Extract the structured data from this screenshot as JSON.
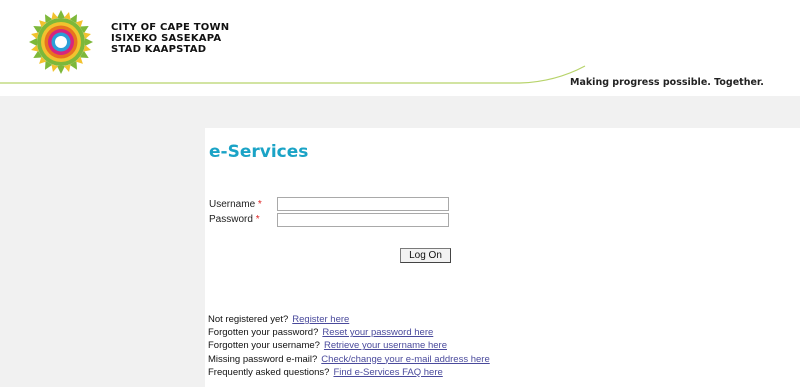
{
  "brand": {
    "line1": "CITY OF CAPE TOWN",
    "line2": "ISIXEKO SASEKAPA",
    "line3": "STAD KAAPSTAD",
    "tagline": "Making progress possible. Together.",
    "logo_icon": "city-of-cape-town-logo-icon",
    "colors": {
      "green": "#7db83a",
      "yellow": "#f2c22e",
      "orange": "#e8731f",
      "pink": "#d7257d",
      "blue": "#2b9fd8",
      "teal": "#1aa3c6"
    }
  },
  "page": {
    "title": "e-Services",
    "title_color": "#1aa3c6"
  },
  "form": {
    "username_label": "Username",
    "password_label": "Password",
    "required_mark": "*",
    "username_value": "",
    "password_value": "",
    "logon_label": "Log On"
  },
  "links": [
    {
      "prompt": "Not registered yet?",
      "link": "Register here"
    },
    {
      "prompt": "Forgotten your password?",
      "link": "Reset your password here"
    },
    {
      "prompt": "Forgotten your username?",
      "link": "Retrieve your username here"
    },
    {
      "prompt": "Missing password e-mail?",
      "link": "Check/change your e-mail address here"
    },
    {
      "prompt": "Frequently asked questions?",
      "link": "Find e-Services FAQ here"
    }
  ]
}
